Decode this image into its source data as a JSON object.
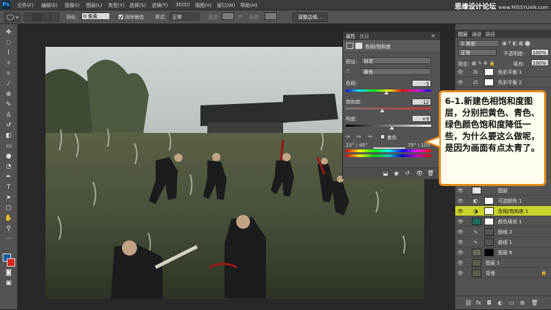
{
  "app": {
    "logo": "Ps",
    "watermark": "思缘设计论坛",
    "watermark_url": "www.MISSYUAN.com"
  },
  "menubar": {
    "items": [
      "文件(F)",
      "编辑(E)",
      "图像(I)",
      "图层(L)",
      "类型(Y)",
      "选择(S)",
      "滤镜(T)",
      "3D(D)",
      "视图(V)",
      "窗口(W)",
      "帮助(H)"
    ]
  },
  "options_bar": {
    "feather_label": "羽化:",
    "feather_value": "0 像素",
    "antialias_label": "消除锯齿",
    "style_label": "样式:",
    "style_value": "正常",
    "width_label": "宽度:",
    "height_label": "高度:",
    "refine_edge_button": "调整边缘..."
  },
  "properties": {
    "tab_properties": "属性",
    "tab_info": "信息",
    "title": "色相/饱和度",
    "preset_label": "预设:",
    "preset_value": "自定",
    "channel_value": "黄色",
    "hue_label": "色相:",
    "hue_value": "-3",
    "saturation_label": "饱和度:",
    "saturation_value": "-12",
    "lightness_label": "明度:",
    "lightness_value": "+9",
    "colorize_label": "着色",
    "range_left": "15° / 45°",
    "range_right": "75° \\ 105°"
  },
  "layers_panel": {
    "tab_layers": "图层",
    "tab_channels": "通道",
    "tab_paths": "路径",
    "filter_kind": "类型",
    "blend_mode": "正常",
    "opacity_label": "不透明度:",
    "opacity_value": "100%",
    "lock_label": "锁定:",
    "fill_label": "填充:",
    "fill_value": "100%",
    "layers": [
      {
        "name": "色彩平衡 1",
        "kind": "adjustment"
      },
      {
        "name": "色彩平衡 2",
        "kind": "adjustment"
      },
      {
        "name": "图层",
        "kind": "pixel"
      },
      {
        "name": "可选颜色 1",
        "kind": "adjustment"
      },
      {
        "name": "色相/饱和度 1",
        "kind": "adjustment",
        "selected": true
      },
      {
        "name": "颜色填充 1",
        "kind": "fill"
      },
      {
        "name": "曲线 2",
        "kind": "adjustment"
      },
      {
        "name": "曲线 1",
        "kind": "adjustment"
      },
      {
        "name": "图层 6",
        "kind": "pixel"
      },
      {
        "name": "图层 1",
        "kind": "pixel"
      },
      {
        "name": "背景",
        "kind": "background"
      }
    ]
  },
  "annotation": {
    "text": "6-1.新建色相饱和度图层，分别把黄色、青色、绿色颜色饱和度降低一些，为什么要这么做呢，是因为画面有点太青了。"
  },
  "colors": {
    "accent_callout_border": "#e58a1a",
    "selected_layer_bg": "#c9d32a",
    "fill_layer_color": "#1f6b5c",
    "foreground_swatch": "#1a5fa0",
    "background_swatch": "#d9281f"
  }
}
